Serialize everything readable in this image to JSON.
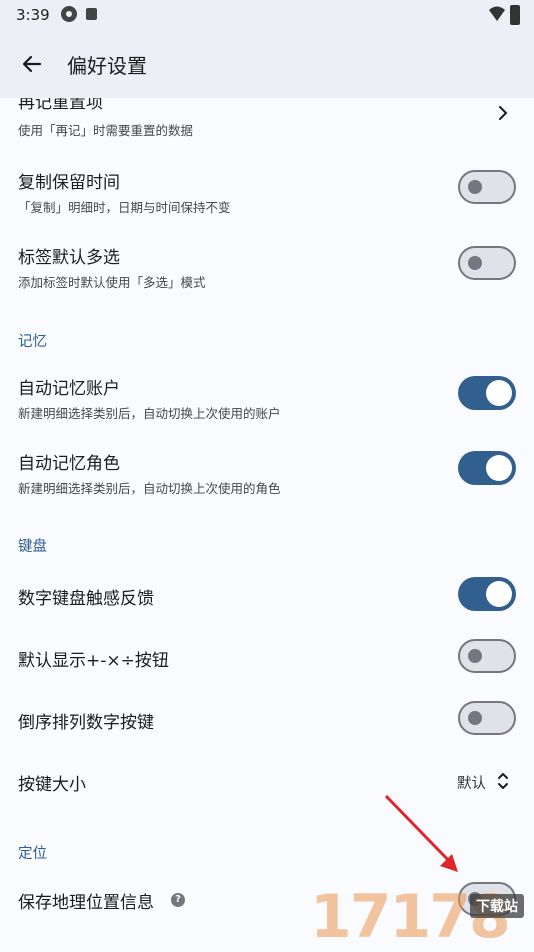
{
  "status_bar": {
    "time": "3:39"
  },
  "app_bar": {
    "title": "偏好设置"
  },
  "general": {
    "reset_items": {
      "title": "再记重置项",
      "subtitle": "使用「再记」时需要重置的数据"
    },
    "copy_keep_time": {
      "title": "复制保留时间",
      "subtitle": "「复制」明细时，日期与时间保持不变",
      "checked": false
    },
    "tag_multi_select": {
      "title": "标签默认多选",
      "subtitle": "添加标签时默认使用「多选」模式",
      "checked": false
    }
  },
  "memory": {
    "header": "记忆",
    "auto_account": {
      "title": "自动记忆账户",
      "subtitle": "新建明细选择类别后，自动切换上次使用的账户",
      "checked": true
    },
    "auto_role": {
      "title": "自动记忆角色",
      "subtitle": "新建明细选择类别后，自动切换上次使用的角色",
      "checked": true
    }
  },
  "keyboard": {
    "header": "键盘",
    "haptic": {
      "title": "数字键盘触感反馈",
      "checked": true
    },
    "show_ops": {
      "title": "默认显示+-×÷按钮",
      "checked": false
    },
    "reverse_digits": {
      "title": "倒序排列数字按键",
      "checked": false
    },
    "key_size": {
      "title": "按键大小",
      "value": "默认"
    }
  },
  "location": {
    "header": "定位",
    "save_location": {
      "title": "保存地理位置信息",
      "checked": false
    }
  },
  "watermark": {
    "text": "17178",
    "badge": "下载站"
  },
  "colors": {
    "accent": "#315f8e",
    "section": "#2e5f93",
    "background": "#fafbfe"
  }
}
